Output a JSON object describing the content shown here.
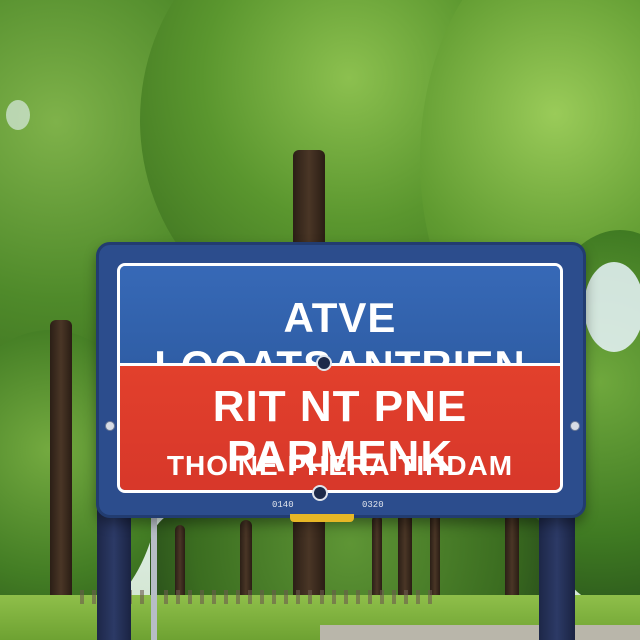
{
  "scene": {
    "description_colors": {
      "sign_blue": "#2f5ea6",
      "sign_red": "#d7372a",
      "foliage_green": "#5a962e",
      "sky": "#cfe9f7"
    }
  },
  "sign": {
    "line1": "ATVE LOOATSANTRIEN",
    "line2": "RIT NT PNE  PARMENK",
    "line3": "THO NE PHERA TIHDAM",
    "marks": [
      "0140",
      "0320"
    ]
  }
}
